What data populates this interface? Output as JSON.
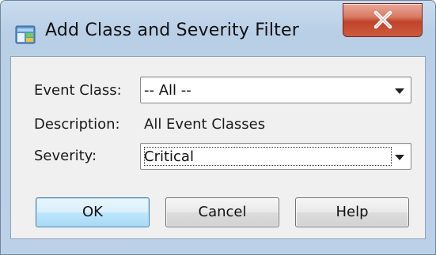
{
  "window": {
    "title": "Add Class and Severity Filter"
  },
  "icons": {
    "app": "dialog-app-icon",
    "close": "close-icon",
    "dropdown": "chevron-down-icon"
  },
  "colors": {
    "close_button": "#c9523a",
    "default_button": "#bee6fd",
    "frame": "#bcd1e8"
  },
  "form": {
    "event_class_label": "Event Class:",
    "event_class_value": "-- All --",
    "description_label": "Description:",
    "description_value": "All Event Classes",
    "severity_label": "Severity:",
    "severity_value": "Critical"
  },
  "buttons": {
    "ok": "OK",
    "cancel": "Cancel",
    "help": "Help"
  }
}
